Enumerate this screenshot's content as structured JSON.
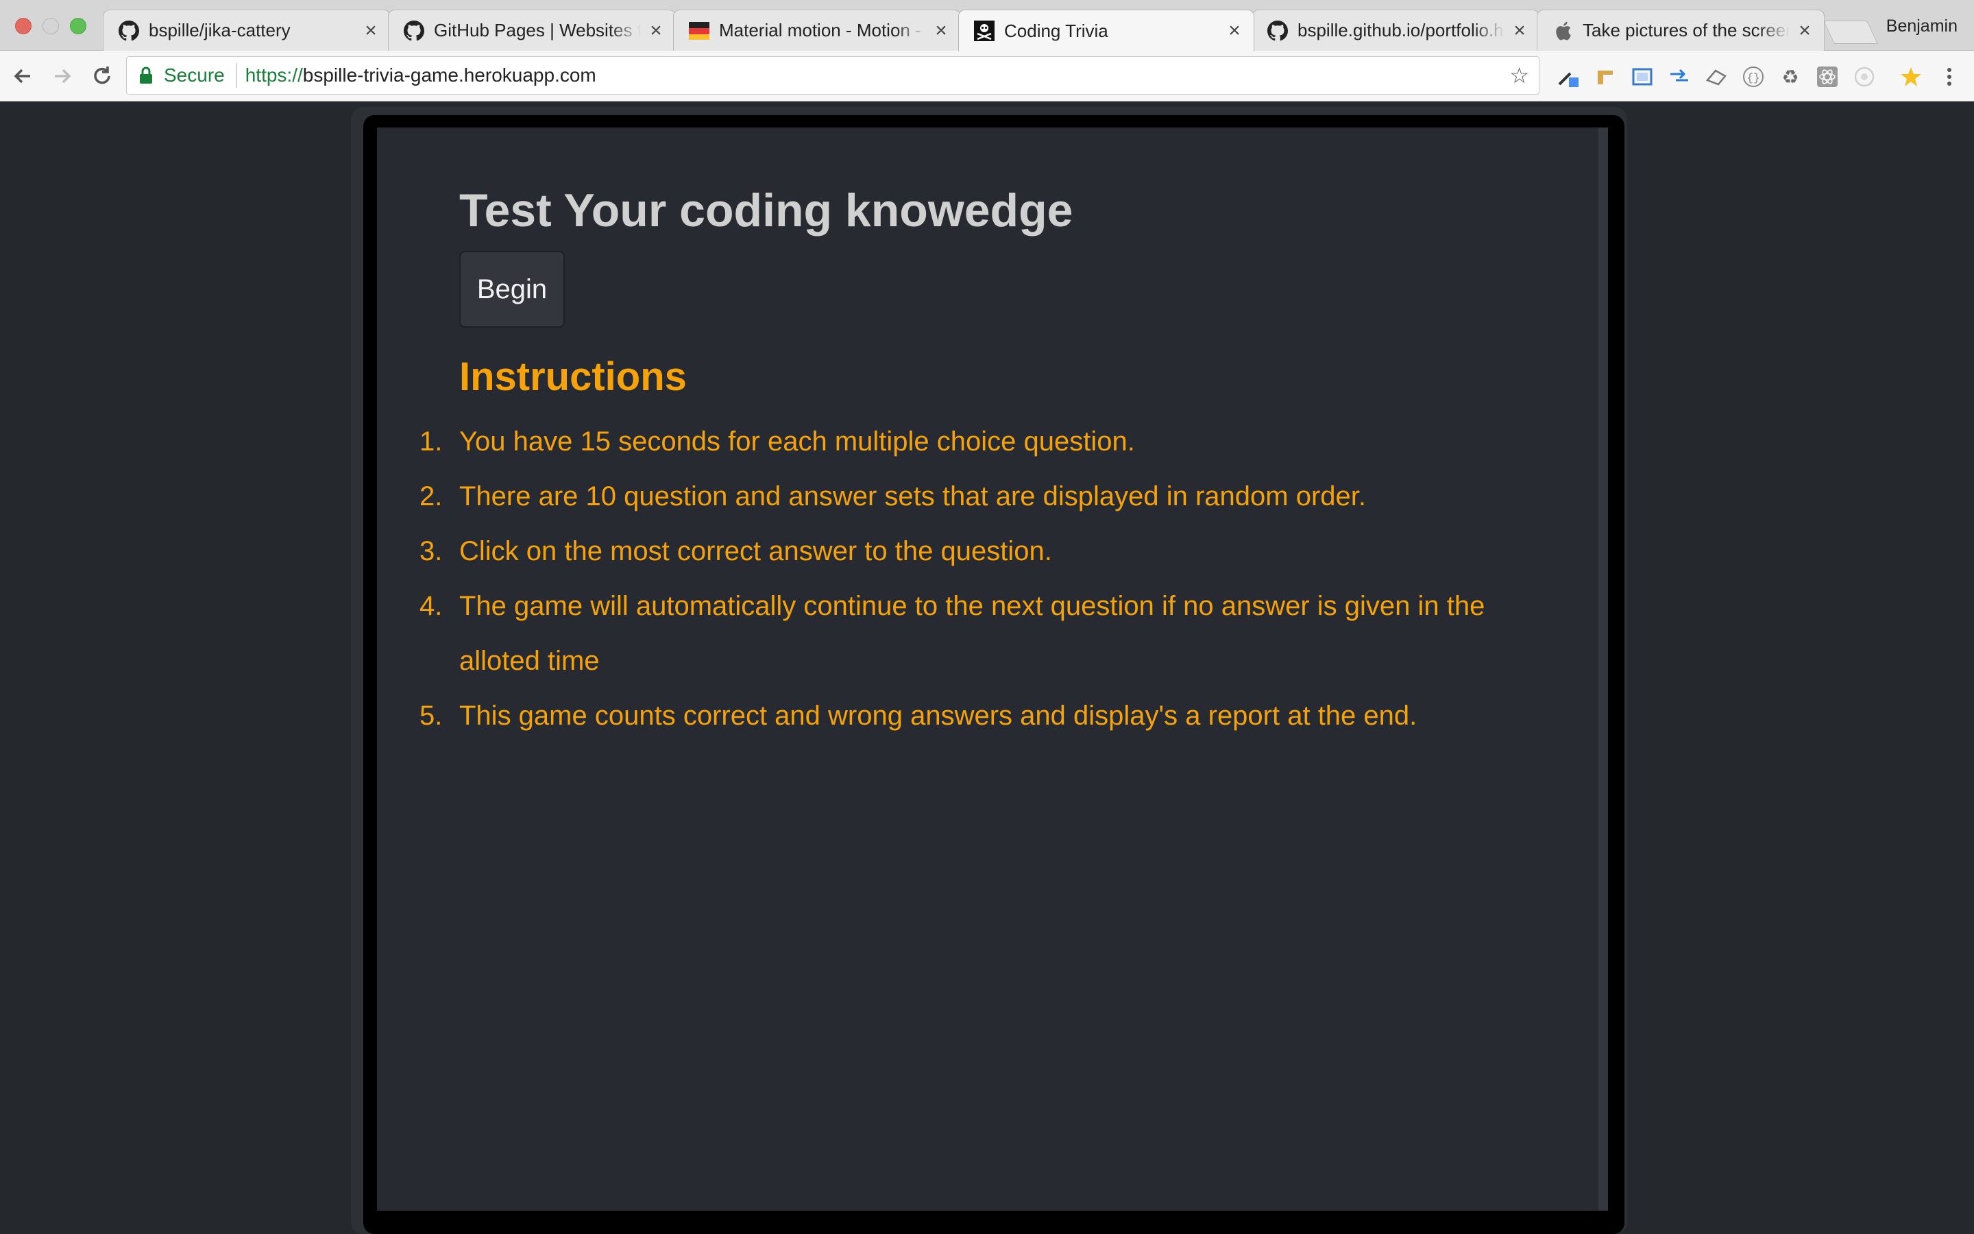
{
  "browser": {
    "profile_name": "Benjamin",
    "tabs": [
      {
        "title": "bspille/jika-cattery",
        "icon": "github-icon",
        "active": false
      },
      {
        "title": "GitHub Pages | Websites for you and your projects",
        "icon": "github-icon",
        "active": false
      },
      {
        "title": "Material motion - Motion - Material Design",
        "icon": "material-design-icon",
        "active": false
      },
      {
        "title": "Coding Trivia",
        "icon": "skull-crossbones-icon",
        "active": true
      },
      {
        "title": "bspille.github.io/portfolio.html",
        "icon": "github-icon",
        "active": false
      },
      {
        "title": "Take pictures of the screen on your Mac",
        "icon": "apple-icon",
        "active": false
      }
    ],
    "close_glyph": "×",
    "address_bar": {
      "secure_label": "Secure",
      "url_scheme": "https://",
      "url_host": "bspille-trivia-game.herokuapp.com"
    }
  },
  "page": {
    "heading": "Test Your coding knowedge",
    "begin_label": "Begin",
    "instructions_title": "Instructions",
    "instructions": [
      {
        "number": "1.",
        "text": "You have 15 seconds for each multiple choice question."
      },
      {
        "number": "2.",
        "text": "There are 10 question and answer sets that are displayed in random order."
      },
      {
        "number": "3.",
        "text": "Click on the most correct answer to the question."
      },
      {
        "number": "4.",
        "text": "The game will automatically continue to the next question if no answer is given in the alloted time"
      },
      {
        "number": "5.",
        "text": "This game counts correct and wrong answers and display's a report at the end."
      }
    ]
  },
  "colors": {
    "page_background": "#25282d",
    "panel_background": "#272a30",
    "heading_text": "#d0d0d0",
    "accent_orange": "#f5a20f",
    "secure_green": "#188038"
  }
}
